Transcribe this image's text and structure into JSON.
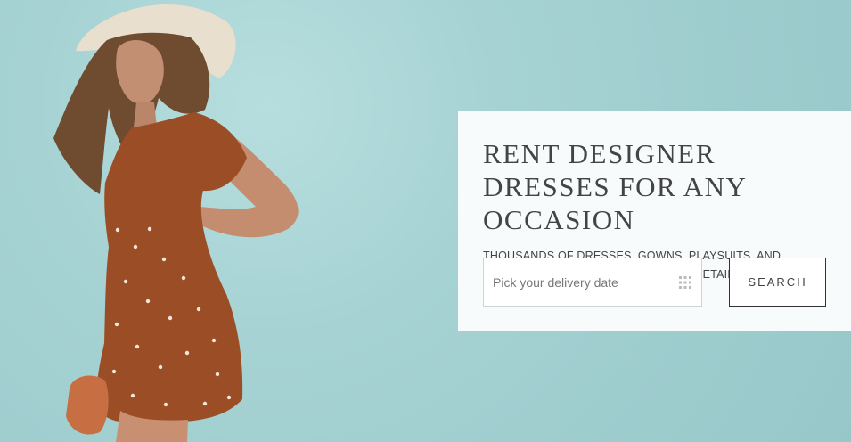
{
  "hero": {
    "headline": "RENT DESIGNER DRESSES FOR ANY OCCASION",
    "subheadline": "THOUSANDS OF DRESSES, GOWNS, PLAYSUITS, AND JUMPSUITS FOR A FRACTION OF THE RETAIL PRICE.",
    "date_placeholder": "Pick your delivery date",
    "search_label": "SEARCH",
    "icons": [
      "grid-icon"
    ],
    "colors": {
      "background": "#9fcdcf",
      "panel": "#f8fbfb",
      "text": "#444444"
    }
  }
}
